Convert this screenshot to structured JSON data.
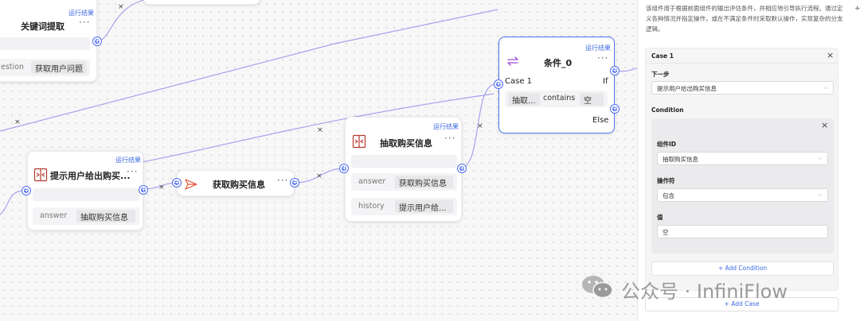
{
  "nodes": {
    "keyword": {
      "run_label": "运行结果",
      "title": "关键词提取",
      "dots": "···",
      "param_key": "estion",
      "param_value": "获取用户问题"
    },
    "prompt": {
      "run_label": "运行结果",
      "title": "提示用户给出购买...",
      "dots": "···",
      "param_key": "answer",
      "param_value": "抽取购买信息"
    },
    "get_info": {
      "title": "获取购买信息",
      "dots": "···"
    },
    "extract": {
      "run_label": "运行结果",
      "title": "抽取购买信息",
      "dots": "···",
      "params": [
        {
          "key": "answer",
          "value": "获取购买信息"
        },
        {
          "key": "history",
          "value": "提示用户给..."
        }
      ]
    },
    "condition": {
      "run_label": "运行结果",
      "title": "条件_0",
      "dots": "···",
      "case_label": "Case 1",
      "if_label": "If",
      "else_label": "Else",
      "expr_component": "抽取...",
      "expr_operator": "contains",
      "expr_value": "空"
    }
  },
  "canvas_marks": {
    "x": "×",
    "plus": "+"
  },
  "panel": {
    "description": "该组件用于根据前面组件的输出评估条件，并相应地引导执行流程。通过定义各种情况并指定操作，或在不满足条件时采取默认操作，实现复杂的分支逻辑。",
    "top_plus": "+",
    "case": {
      "title": "Case 1",
      "close": "×",
      "next_step_label": "下一步",
      "next_step_value": "提示用户给出购买信息",
      "condition_label": "Condition",
      "condition_close": "×",
      "component_id_label": "组件ID",
      "component_id_value": "抽取购买信息",
      "operator_label": "操作符",
      "operator_value": "包含",
      "value_label": "值",
      "value_value": "空",
      "add_condition": "+ Add Condition"
    },
    "add_case": "+ Add Case"
  },
  "watermark": {
    "text": "公众号 · InfiniFlow"
  },
  "colors": {
    "accent": "#4f6df0",
    "link": "#3e6ae0",
    "edge": "#a6a3ea",
    "condition_icon": "#a04bd6",
    "send_icon": "#e0553a",
    "extract_icon": "#b33a2e"
  }
}
